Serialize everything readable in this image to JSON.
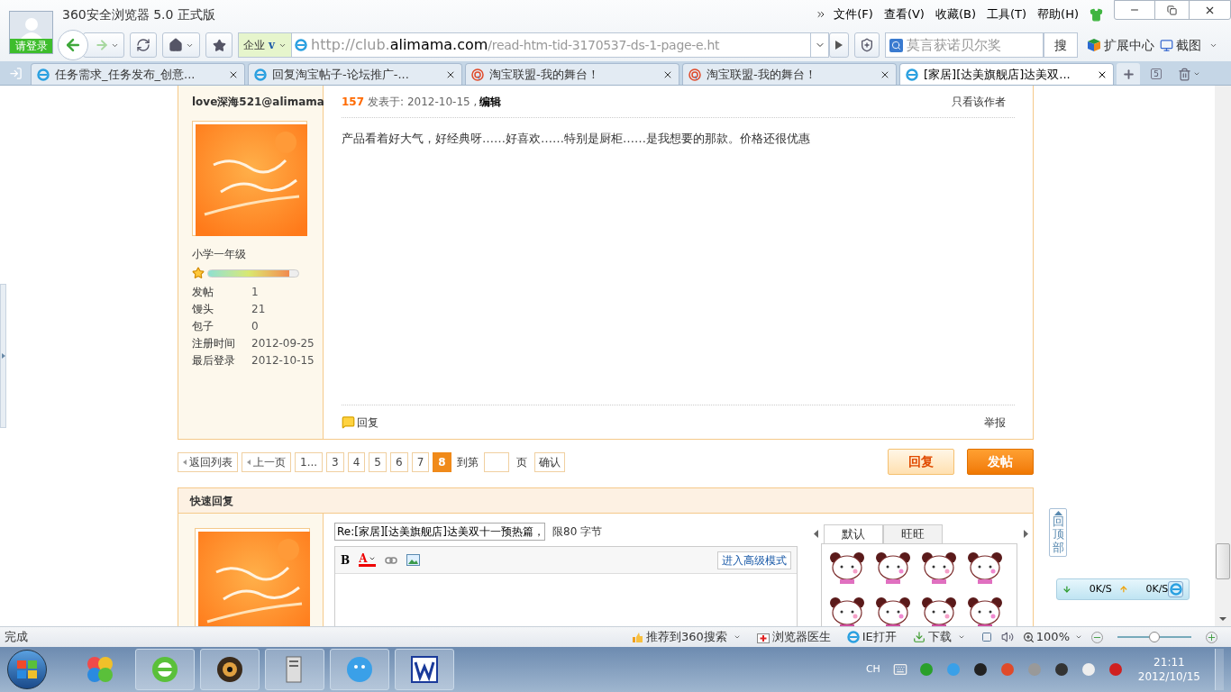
{
  "browser": {
    "title": "360安全浏览器 5.0 正式版",
    "login": "请登录",
    "menu": [
      "文件(F)",
      "查看(V)",
      "收藏(B)",
      "工具(T)",
      "帮助(H)"
    ],
    "enterprise": "企业",
    "enterprise_badge": "v",
    "url_prefix": "http://club.",
    "url_host": "alimama.com",
    "url_path": "/read-htm-tid-3170537-ds-1-page-e.ht",
    "search_placeholder": "莫言获诺贝尔奖",
    "search_button": "搜",
    "extensions": "扩展中心",
    "screenshot": "截图"
  },
  "tabs": [
    {
      "label": "任务需求_任务发布_创意...",
      "kind": "ie",
      "selected": false
    },
    {
      "label": "回复淘宝帖子-论坛推广-...",
      "kind": "ie",
      "selected": false
    },
    {
      "label": "淘宝联盟-我的舞台！",
      "kind": "alimama",
      "selected": false
    },
    {
      "label": "淘宝联盟-我的舞台！",
      "kind": "alimama",
      "selected": false
    },
    {
      "label": "[家居][达美旗舰店]达美双...",
      "kind": "ie",
      "selected": true
    }
  ],
  "tab_count": "5",
  "post": {
    "author": "love深海521@alimama",
    "rank": "小学一年级",
    "level": 0.9,
    "stats": [
      {
        "label": "发帖",
        "value": "1"
      },
      {
        "label": "馒头",
        "value": "21"
      },
      {
        "label": "包子",
        "value": "0"
      },
      {
        "label": "注册时间",
        "value": "2012-09-25"
      },
      {
        "label": "最后登录",
        "value": "2012-10-15"
      }
    ],
    "floor": "157",
    "posted": "发表于: 2012-10-15 ,",
    "edit": "编辑",
    "only_author": "只看该作者",
    "body": "产品看着好大气，好经典呀……好喜欢……特别是厨柜……是我想要的那款。价格还很优惠",
    "reply": "回复",
    "report": "举报"
  },
  "pagination": {
    "items": [
      {
        "label": "返回列表",
        "kind": "nav",
        "selected": false
      },
      {
        "label": "上一页",
        "kind": "nav",
        "selected": false
      },
      {
        "label": "1...",
        "kind": "page",
        "selected": false
      },
      {
        "label": "3",
        "kind": "page",
        "selected": false
      },
      {
        "label": "4",
        "kind": "page",
        "selected": false
      },
      {
        "label": "5",
        "kind": "page",
        "selected": false
      },
      {
        "label": "6",
        "kind": "page",
        "selected": false
      },
      {
        "label": "7",
        "kind": "page",
        "selected": false
      },
      {
        "label": "8",
        "kind": "page",
        "selected": true
      }
    ],
    "goto": "到第",
    "page_unit": "页",
    "confirm": "确认",
    "reply_button": "回复",
    "post_button": "发帖"
  },
  "quick_reply": {
    "title": "快速回复",
    "subject": "Re:[家居][达美旗舰店]达美双十一预热篇，",
    "limit": "限80 字节",
    "bold_label": "B",
    "color_label": "A",
    "advanced": "进入高级模式",
    "emoticon_tabs": [
      {
        "label": "默认",
        "selected": true
      },
      {
        "label": "旺旺",
        "selected": false
      }
    ]
  },
  "side": {
    "back_to_top": "回顶部",
    "download_speed": "0K/S",
    "upload_speed": "0K/S"
  },
  "status_bar": {
    "text": "完成",
    "items": [
      "推荐到360搜索",
      "浏览器医生",
      "IE打开",
      "下载"
    ],
    "zoom": "100%",
    "zoom_slider": {
      "level": 0.5
    }
  },
  "taskbar": {
    "language": "CH",
    "time": "21:11",
    "date": "2012/10/15"
  }
}
